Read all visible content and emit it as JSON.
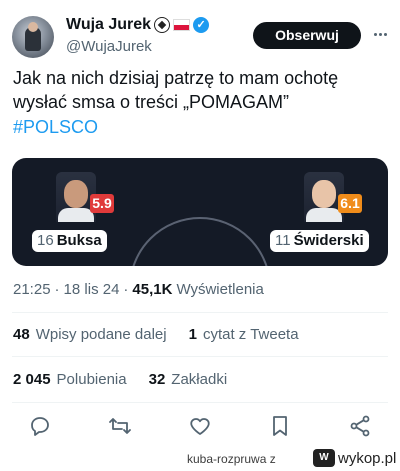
{
  "author": {
    "name": "Wuja Jurek",
    "handle": "@WujaJurek"
  },
  "follow_label": "Obserwuj",
  "tweet": {
    "text": "Jak na nich dzisiaj patrzę to mam ochotę wysłać smsa o treści „POMAGAM”",
    "hashtag": "#POLSCO"
  },
  "media": {
    "players": [
      {
        "number": "16",
        "name": "Buksa",
        "rating": "5.9",
        "rating_color": "#e03a3a"
      },
      {
        "number": "11",
        "name": "Świderski",
        "rating": "6.1",
        "rating_color": "#f08c1a"
      }
    ]
  },
  "meta": {
    "time": "21:25",
    "sep1": "·",
    "date": "18 lis 24",
    "sep2": "·",
    "views_count": "45,1K",
    "views_label": "Wyświetlenia"
  },
  "stats": {
    "reposts_count": "48",
    "reposts_label": "Wpisy podane dalej",
    "quotes_count": "1",
    "quotes_label": "cytat z Tweeta",
    "likes_count": "2 045",
    "likes_label": "Polubienia",
    "bookmarks_count": "32",
    "bookmarks_label": "Zakładki"
  },
  "actions": [
    "reply-icon",
    "retweet-icon",
    "like-icon",
    "bookmark-icon",
    "share-icon"
  ],
  "footer": {
    "user": "kuba-rozpruwa",
    "separator": "z",
    "site": "wykop.pl",
    "site_mark": "W"
  },
  "colors": {
    "accent": "#1d9bf0",
    "text": "#0f1419",
    "muted": "#536471",
    "media_bg": "#141a26"
  }
}
